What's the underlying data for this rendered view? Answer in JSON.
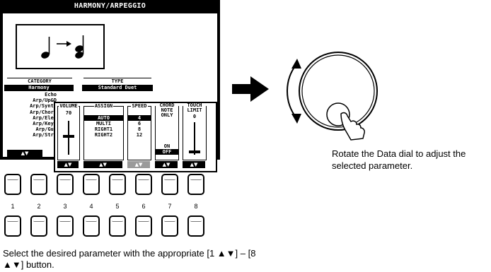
{
  "screen": {
    "title": "HARMONY/ARPEGGIO",
    "category": {
      "header": "CATEGORY",
      "selected": "Harmony",
      "items": [
        "Echo",
        "Arp/Up&D",
        "Arp/Synth",
        "Arp/Chord",
        "Arp/Elec",
        "Arp/Keyb",
        "Arp/Gui",
        "Arp/Stri"
      ],
      "button": "▲▼"
    },
    "type": {
      "header": "TYPE",
      "selected": "Standard Duet"
    },
    "volume": {
      "label": "VOLUME",
      "value": "70",
      "level": 0.55,
      "button": "▲▼"
    },
    "assign": {
      "label": "ASSIGN",
      "options": [
        "AUTO",
        "MULTI",
        "RIGHT1",
        "RIGHT2"
      ],
      "selected": "AUTO",
      "button": "▲▼"
    },
    "speed": {
      "label": "SPEED",
      "options": [
        "4",
        "6",
        "8",
        "12"
      ],
      "selected": "4",
      "button": "▲▼"
    },
    "chord_note_only": {
      "label": "CHORD NOTE ONLY",
      "options": [
        "ON",
        "OFF"
      ],
      "selected": "OFF",
      "button": "▲▼"
    },
    "touch_limit": {
      "label": "TOUCH LIMIT",
      "value": "0",
      "level": 0.05,
      "button": "▲▼"
    }
  },
  "buttons": {
    "numbers": [
      "1",
      "2",
      "3",
      "4",
      "5",
      "6",
      "7",
      "8"
    ]
  },
  "captions": {
    "select_parameter": "Select the desired parameter with the appropriate [1 ▲▼] – [8 ▲▼] button.",
    "rotate_dial": "Rotate the Data dial to adjust the selected parameter."
  }
}
